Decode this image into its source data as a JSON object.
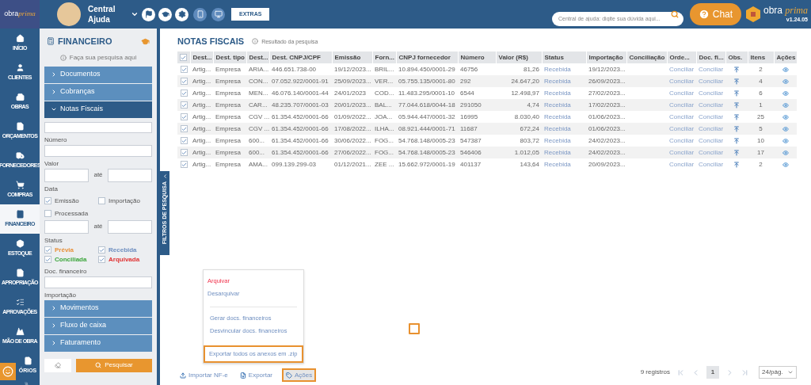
{
  "header": {
    "logo_left": {
      "word1": "obra",
      "word2": "prima"
    },
    "help_title": "Central Ajuda",
    "extras_button": "EXTRAS",
    "search": {
      "placeholder": "Central de ajuda: digite sua dúvida aqui..."
    },
    "chat_button": "Chat",
    "logo_right": {
      "word1": "obra",
      "word2": "prima",
      "version": "v1.24.05"
    }
  },
  "nav": [
    {
      "label": "INÍCIO",
      "selected": false
    },
    {
      "label": "CLIENTES",
      "selected": false
    },
    {
      "label": "OBRAS",
      "selected": false
    },
    {
      "label": "ORÇAMENTOS",
      "selected": false
    },
    {
      "label": "FORNECEDORES",
      "selected": false
    },
    {
      "label": "COMPRAS",
      "selected": false
    },
    {
      "label": "FINANCEIRO",
      "selected": true
    },
    {
      "label": "ESTOQUE",
      "selected": false
    },
    {
      "label": "APROPRIAÇÃO",
      "selected": false
    },
    {
      "label": "APROVAÇÕES",
      "selected": false
    },
    {
      "label": "MÃO DE OBRA",
      "selected": false
    },
    {
      "label": "ÓRIOS",
      "selected": false
    }
  ],
  "filter_panel": {
    "title": "FINANCEIRO",
    "hint": "Faça sua pesquisa aqui",
    "sections_top": [
      {
        "label": "Documentos",
        "expanded": false
      },
      {
        "label": "Cobranças",
        "expanded": false
      },
      {
        "label": "Notas Fiscais",
        "expanded": true
      }
    ],
    "numero_label": "Número",
    "valor_label": "Valor",
    "valor_separator": "até",
    "data_label": "Data",
    "data_options": [
      {
        "label": "Emissão",
        "checked": true
      },
      {
        "label": "Importação",
        "checked": false
      },
      {
        "label": "Processada",
        "checked": false
      }
    ],
    "data_separator": "até",
    "status_label": "Status",
    "status_options": [
      {
        "label": "Prévia",
        "checked": true,
        "color": "#e8913a"
      },
      {
        "label": "Recebida",
        "checked": true,
        "color": "#6f8fc0"
      },
      {
        "label": "Conciliada",
        "checked": true,
        "color": "#3aa53a"
      },
      {
        "label": "Arquivada",
        "checked": true,
        "color": "#e03131"
      }
    ],
    "doc_label": "Doc. financeiro",
    "importacao_label": "Importação",
    "sections_bottom": [
      {
        "label": "Movimentos",
        "expanded": false
      },
      {
        "label": "Fluxo de caixa",
        "expanded": false
      },
      {
        "label": "Faturamento",
        "expanded": false
      }
    ],
    "search_button": "Pesquisar"
  },
  "side_tab": "FILTROS DE PESQUISA",
  "main": {
    "title": "NOTAS FISCAIS",
    "subtitle": "Resultado da pesquisa",
    "table": {
      "all_checked": true,
      "columns": [
        "Dest...",
        "Dest. tipo",
        "Dest...",
        "Dest. CNPJ/CPF",
        "Emissão",
        "Forn...",
        "CNPJ fornecedor",
        "Número",
        "Valor (R$)",
        "Status",
        "Importação",
        "Conciliação",
        "Orde...",
        "Doc. fi...",
        "Obs.",
        "Itens",
        "Ações"
      ],
      "rows": [
        {
          "checked": true,
          "dest": "Artig...",
          "tipo": "Empresa",
          "dest2": "ARIA...",
          "cnpj": "446.651.738-00",
          "emissao": "19/12/2023...",
          "forn": "BRIL...",
          "cnpj_forn": "10.894.450/0001-29",
          "numero": "46756",
          "valor": "81,26",
          "status": "Recebida",
          "importacao": "19/12/2023...",
          "ordem": "Conciliar",
          "doc": "Conciliar",
          "itens": "2"
        },
        {
          "checked": true,
          "dest": "Artig...",
          "tipo": "Empresa",
          "dest2": "CON...",
          "cnpj": "07.052.922/0001-91",
          "emissao": "25/09/2023...",
          "forn": "VER...",
          "cnpj_forn": "05.755.135/0001-80",
          "numero": "292",
          "valor": "24.647,20",
          "status": "Recebida",
          "importacao": "26/09/2023...",
          "ordem": "Conciliar",
          "doc": "Conciliar",
          "itens": "4"
        },
        {
          "checked": true,
          "dest": "Artig...",
          "tipo": "Empresa",
          "dest2": "MEN...",
          "cnpj": "46.076.140/0001-44",
          "emissao": "24/01/2023",
          "forn": "COD...",
          "cnpj_forn": "11.483.295/0001-10",
          "numero": "6544",
          "valor": "12.498,97",
          "status": "Recebida",
          "importacao": "27/02/2023...",
          "ordem": "Conciliar",
          "doc": "Conciliar",
          "itens": "6"
        },
        {
          "checked": true,
          "dest": "Artig...",
          "tipo": "Empresa",
          "dest2": "CAR...",
          "cnpj": "48.235.707/0001-03",
          "emissao": "20/01/2023...",
          "forn": "BAL...",
          "cnpj_forn": "77.044.618/0044-18",
          "numero": "291050",
          "valor": "4,74",
          "status": "Recebida",
          "importacao": "17/02/2023...",
          "ordem": "Conciliar",
          "doc": "Conciliar",
          "itens": "1"
        },
        {
          "checked": true,
          "dest": "Artig...",
          "tipo": "Empresa",
          "dest2": "CGV ...",
          "cnpj": "61.354.452/0001-66",
          "emissao": "01/09/2022...",
          "forn": "JOA...",
          "cnpj_forn": "05.944.447/0001-32",
          "numero": "16995",
          "valor": "8.030,40",
          "status": "Recebida",
          "importacao": "01/06/2023...",
          "ordem": "Conciliar",
          "doc": "Conciliar",
          "itens": "25"
        },
        {
          "checked": true,
          "dest": "Artig...",
          "tipo": "Empresa",
          "dest2": "CGV ...",
          "cnpj": "61.354.452/0001-66",
          "emissao": "17/08/2022...",
          "forn": "ILHA...",
          "cnpj_forn": "08.921.444/0001-71",
          "numero": "11687",
          "valor": "672,24",
          "status": "Recebida",
          "importacao": "01/06/2023...",
          "ordem": "Conciliar",
          "doc": "Conciliar",
          "itens": "5"
        },
        {
          "checked": true,
          "dest": "Artig...",
          "tipo": "Empresa",
          "dest2": "600...",
          "cnpj": "61.354.452/0001-66",
          "emissao": "30/06/2022...",
          "forn": "FOG...",
          "cnpj_forn": "54.768.148/0005-23",
          "numero": "547387",
          "valor": "803,72",
          "status": "Recebida",
          "importacao": "24/02/2023...",
          "ordem": "Conciliar",
          "doc": "Conciliar",
          "itens": "10"
        },
        {
          "checked": true,
          "dest": "Artig...",
          "tipo": "Empresa",
          "dest2": "600...",
          "cnpj": "61.354.452/0001-66",
          "emissao": "27/06/2022...",
          "forn": "FOG...",
          "cnpj_forn": "54.768.148/0005-23",
          "numero": "546406",
          "valor": "1.012,05",
          "status": "Recebida",
          "importacao": "24/02/2023...",
          "ordem": "Conciliar",
          "doc": "Conciliar",
          "itens": "17"
        },
        {
          "checked": true,
          "dest": "Artig...",
          "tipo": "Empresa",
          "dest2": "AMA...",
          "cnpj": "099.139.299-03",
          "emissao": "01/12/2021...",
          "forn": "ZEE ...",
          "cnpj_forn": "15.662.972/0001-19",
          "numero": "401137",
          "valor": "143,64",
          "status": "Recebida",
          "importacao": "20/09/2023...",
          "ordem": "Conciliar",
          "doc": "Conciliar",
          "itens": "2"
        }
      ]
    },
    "actions_menu": {
      "groups": [
        [
          {
            "label": "Arquivar",
            "kind": "danger",
            "highlighted": false
          },
          {
            "label": "Desarquivar",
            "kind": "normal",
            "highlighted": false
          }
        ],
        [
          {
            "label": "Gerar docs. financeiros",
            "kind": "normal",
            "highlighted": false
          },
          {
            "label": "Desvincular docs. financeiros",
            "kind": "normal",
            "highlighted": false
          }
        ],
        [
          {
            "label": "Exportar todos os anexos em .zip",
            "kind": "normal",
            "highlighted": true
          }
        ]
      ]
    },
    "toolbar": [
      {
        "label": "Importar NF-e",
        "kind": "import",
        "selected": false
      },
      {
        "label": "Exportar",
        "kind": "export",
        "selected": false
      },
      {
        "label": "Ações",
        "kind": "actions",
        "selected": true
      }
    ],
    "pagination": {
      "count": "9 registros",
      "pages": [
        {
          "label": "1",
          "selected": true
        }
      ],
      "page_size": "24/pág."
    }
  }
}
